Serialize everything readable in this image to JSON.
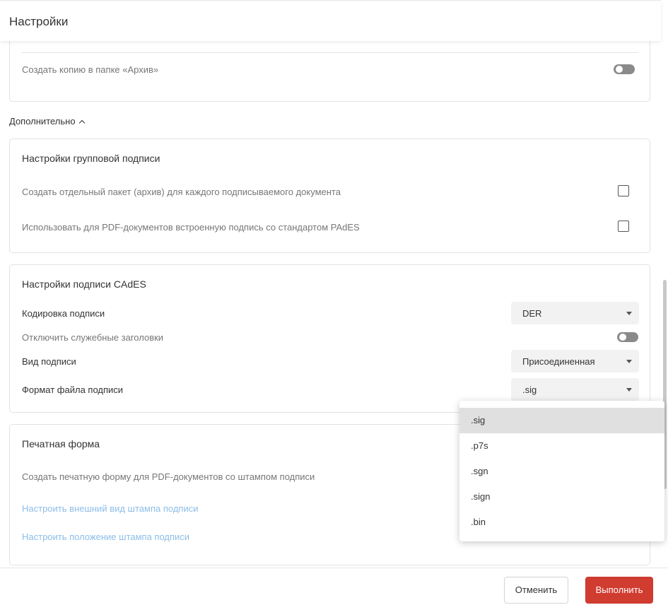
{
  "header": {
    "title": "Настройки"
  },
  "archive_card": {
    "copy_to_archive_label": "Создать копию в папке «Архив»"
  },
  "advanced": {
    "label": "Дополнительно"
  },
  "group_sign": {
    "title": "Настройки групповой подписи",
    "separate_package_label": "Создать отдельный пакет (архив) для каждого подписываемого документа",
    "pades_label": "Использовать для PDF-документов встроенную подпись со стандартом PAdES"
  },
  "cades": {
    "title": "Настройки подписи CAdES",
    "encoding_label": "Кодировка подписи",
    "encoding_value": "DER",
    "disable_headers_label": "Отключить служебные заголовки",
    "sign_type_label": "Вид подписи",
    "sign_type_value": "Присоединенная",
    "file_format_label": "Формат файла подписи",
    "file_format_value": ".sig"
  },
  "print_form": {
    "title": "Печатная форма",
    "create_label": "Создать печатную форму для PDF-документов со штампом подписи",
    "stamp_appearance_link": "Настроить внешний вид штампа подписи",
    "stamp_position_link": "Настроить положение штампа подписи"
  },
  "format_dropdown": {
    "options": [
      ".sig",
      ".p7s",
      ".sgn",
      ".sign",
      ".bin"
    ],
    "selected": ".sig"
  },
  "footer": {
    "cancel_label": "Отменить",
    "run_label": "Выполнить"
  },
  "colors": {
    "accent_red": "#d13c30",
    "link_blue": "#8cbde8",
    "toggle_off": "#8a8a8a"
  }
}
